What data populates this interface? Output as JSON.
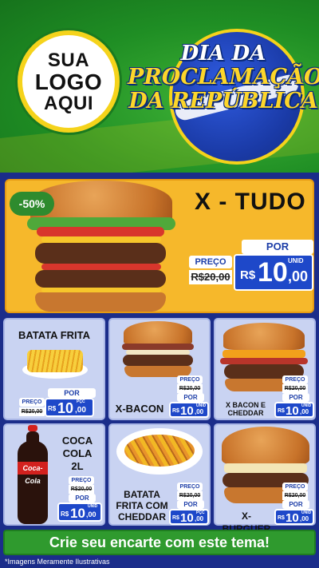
{
  "header": {
    "logo_line1": "SUA",
    "logo_line2": "LOGO",
    "logo_line3": "AQUI",
    "title_line1": "DIA DA",
    "title_line2": "PROCLAMAÇÃO",
    "title_line3": "DA REPÚBLICA"
  },
  "hero": {
    "discount": "-50%",
    "title": "X - TUDO",
    "label_preco": "PREÇO",
    "old_price": "R$20,00",
    "label_por": "POR",
    "currency": "R$",
    "price_int": "10",
    "price_dec": ",00",
    "unit": "UNID"
  },
  "products": [
    {
      "name": "BATATA FRITA",
      "label_preco": "PREÇO",
      "old_price": "R$20,00",
      "label_por": "POR",
      "currency": "R$",
      "price_int": "10",
      "price_dec": ",00",
      "unit": "PÇC"
    },
    {
      "name": "X-BACON",
      "label_preco": "PREÇO",
      "old_price": "R$20,00",
      "label_por": "POR",
      "currency": "R$",
      "price_int": "10",
      "price_dec": ",00",
      "unit": "UNID"
    },
    {
      "name_line1": "X BACON E",
      "name_line2": "CHEDDAR",
      "label_preco": "PREÇO",
      "old_price": "R$20,00",
      "label_por": "POR",
      "currency": "R$",
      "price_int": "10",
      "price_dec": ",00",
      "unit": "UNID"
    },
    {
      "name_line1": "COCA",
      "name_line2": "COLA",
      "name_line3": "2L",
      "label_preco": "PREÇO",
      "old_price": "R$20,00",
      "label_por": "POR",
      "currency": "R$",
      "price_int": "10",
      "price_dec": ",00",
      "unit": "UNID"
    },
    {
      "name_line1": "BATATA",
      "name_line2": "FRITA COM",
      "name_line3": "CHEDDAR",
      "label_preco": "PREÇO",
      "old_price": "R$20,00",
      "label_por": "POR",
      "currency": "R$",
      "price_int": "10",
      "price_dec": ",00",
      "unit": "PÇC"
    },
    {
      "name": "X-BURGUER",
      "label_preco": "PREÇO",
      "old_price": "R$20,00",
      "label_por": "POR",
      "currency": "R$",
      "price_int": "10",
      "price_dec": ",00",
      "unit": "UNID"
    }
  ],
  "bottle_brand": "Coca-Cola",
  "footer": {
    "cta": "Crie seu encarte com este tema!",
    "disclaimer": "*Imagens Meramente Ilustrativas"
  },
  "colors": {
    "header_green": "#1f8e24",
    "hero_orange": "#f6b82b",
    "price_blue": "#1e48c9",
    "card_bg": "#c9d3f2",
    "page_bg": "#1b2d8a",
    "cta_green": "#2f9a2e",
    "title_yellow": "#fdd62a"
  }
}
